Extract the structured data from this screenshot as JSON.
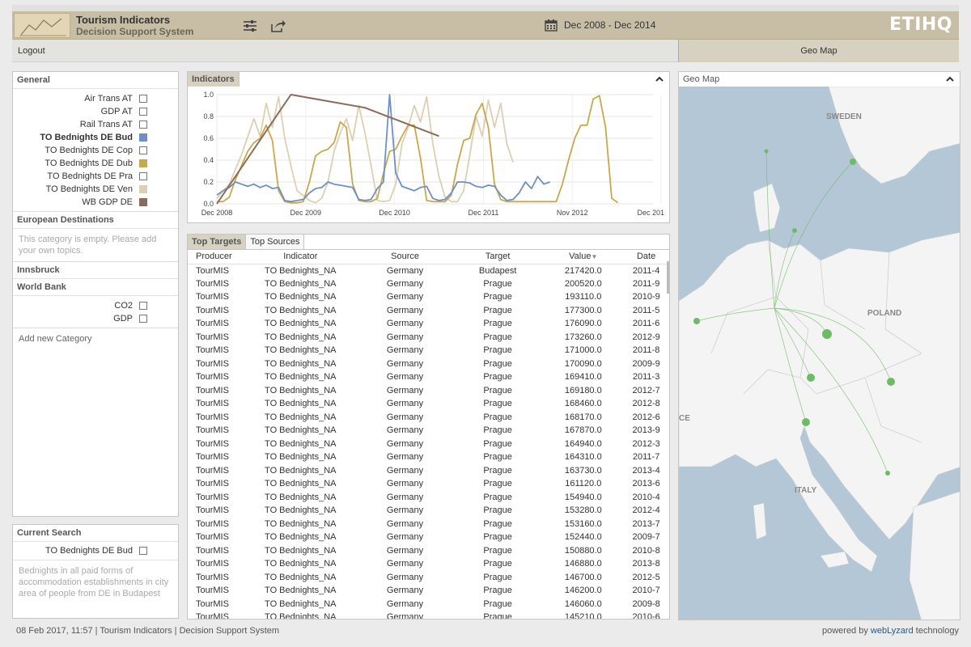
{
  "header": {
    "title": "Tourism Indicators",
    "subtitle": "Decision Support System",
    "date_range": "Dec 2008 - Dec 2014",
    "brand": "ETIHQ"
  },
  "menubar": {
    "logout": "Logout",
    "geo_tab": "Geo Map"
  },
  "sidebar": {
    "general_title": "General",
    "general_items": [
      {
        "label": "Air Trans AT",
        "color": ""
      },
      {
        "label": "GDP AT",
        "color": ""
      },
      {
        "label": "Rail Trans AT",
        "color": ""
      },
      {
        "label": "TO Bednights DE Bud",
        "color": "#6f8fc7"
      },
      {
        "label": "TO Bednights DE Cop",
        "color": ""
      },
      {
        "label": "TO Bednights DE Dub",
        "color": "#c9a84b"
      },
      {
        "label": "TO Bednights DE Pra",
        "color": ""
      },
      {
        "label": "TO Bednights DE Ven",
        "color": "#ddd0b2"
      },
      {
        "label": "WB GDP DE",
        "color": "#8b6b59"
      }
    ],
    "european_title": "European Destinations",
    "european_empty": "This category is empty. Please add your own topics.",
    "innsbruck_title": "Innsbruck",
    "worldbank_title": "World Bank",
    "worldbank_items": [
      "CO2",
      "GDP"
    ],
    "add_category": "Add new Category",
    "current_search_title": "Current Search",
    "current_search_item": "TO Bednights DE Bud",
    "current_search_desc": "Bednights in all paid forms of accommodation establishments in city area of people from DE in Budapest"
  },
  "indicators": {
    "tab": "Indicators"
  },
  "chart_data": {
    "type": "line",
    "x_tick_labels": [
      "Dec 2008",
      "Dec 2009",
      "Dec 2010",
      "Dec 2011",
      "Nov 2012",
      "Dec 201"
    ],
    "y_tick_labels": [
      "0.0",
      "0.2",
      "0.4",
      "0.6",
      "0.8",
      "1.0"
    ],
    "ylim": [
      0,
      1
    ],
    "x_range_months": [
      0,
      72
    ],
    "series": [
      {
        "name": "TO Bednights DE Ven",
        "color": "#ddd0b2",
        "values": [
          [
            0,
            0.05
          ],
          [
            2,
            0.18
          ],
          [
            4,
            0.45
          ],
          [
            6,
            0.78
          ],
          [
            7,
            0.62
          ],
          [
            8,
            0.92
          ],
          [
            9,
            0.7
          ],
          [
            10,
            0.98
          ],
          [
            11,
            0.6
          ],
          [
            12,
            0.35
          ],
          [
            13,
            0.12
          ],
          [
            15,
            0.03
          ],
          [
            16,
            0.01
          ],
          [
            17,
            0.05
          ],
          [
            18,
            0.2
          ],
          [
            19,
            0.48
          ],
          [
            20,
            0.65
          ],
          [
            21,
            0.78
          ],
          [
            22,
            0.58
          ],
          [
            23,
            0.9
          ],
          [
            24,
            0.65
          ],
          [
            25,
            0.35
          ],
          [
            26,
            0.03
          ],
          [
            27,
            0.02
          ],
          [
            28,
            0.03
          ],
          [
            29,
            0.18
          ],
          [
            30,
            0.55
          ],
          [
            31,
            0.7
          ],
          [
            32,
            0.9
          ],
          [
            33,
            0.75
          ],
          [
            34,
            0.98
          ],
          [
            35,
            0.55
          ],
          [
            36,
            0.25
          ],
          [
            37,
            0.06
          ],
          [
            38,
            0.02
          ],
          [
            39,
            0.02
          ],
          [
            40,
            0.12
          ],
          [
            41,
            0.45
          ],
          [
            42,
            0.8
          ],
          [
            43,
            0.62
          ],
          [
            44,
            0.95
          ],
          [
            45,
            0.7
          ],
          [
            46,
            0.92
          ],
          [
            47,
            0.55
          ],
          [
            48,
            0.38
          ]
        ]
      },
      {
        "name": "TO Bednights DE Dub",
        "color": "#c9a84b",
        "values": [
          [
            0,
            0.02
          ],
          [
            1,
            0.02
          ],
          [
            2,
            0.06
          ],
          [
            3,
            0.22
          ],
          [
            4,
            0.35
          ],
          [
            5,
            0.48
          ],
          [
            6,
            0.56
          ],
          [
            7,
            0.6
          ],
          [
            8,
            0.72
          ],
          [
            9,
            0.58
          ],
          [
            10,
            0.12
          ],
          [
            11,
            0.02
          ],
          [
            12,
            0.01
          ],
          [
            13,
            0.01
          ],
          [
            14,
            0.02
          ],
          [
            15,
            0.2
          ],
          [
            16,
            0.44
          ],
          [
            17,
            0.48
          ],
          [
            18,
            0.5
          ],
          [
            19,
            0.56
          ],
          [
            20,
            0.75
          ],
          [
            21,
            0.7
          ],
          [
            22,
            0.18
          ],
          [
            23,
            0.03
          ],
          [
            24,
            0.02
          ],
          [
            25,
            0.02
          ],
          [
            26,
            0.05
          ],
          [
            27,
            0.28
          ],
          [
            28,
            0.48
          ],
          [
            29,
            0.5
          ],
          [
            30,
            0.62
          ],
          [
            31,
            0.72
          ],
          [
            32,
            0.72
          ],
          [
            33,
            0.42
          ],
          [
            34,
            0.03
          ],
          [
            35,
            0.02
          ],
          [
            36,
            0.02
          ],
          [
            37,
            0.02
          ],
          [
            38,
            0.08
          ],
          [
            39,
            0.36
          ],
          [
            40,
            0.58
          ],
          [
            41,
            0.6
          ],
          [
            42,
            0.82
          ],
          [
            43,
            0.92
          ],
          [
            44,
            0.7
          ],
          [
            45,
            0.18
          ],
          [
            46,
            0.04
          ],
          [
            47,
            0.02
          ],
          [
            48,
            0.02
          ],
          [
            54,
            0.02
          ],
          [
            55,
            0.02
          ],
          [
            56,
            0.18
          ],
          [
            57,
            0.4
          ],
          [
            58,
            0.6
          ],
          [
            59,
            0.72
          ],
          [
            60,
            0.72
          ],
          [
            61,
            0.96
          ],
          [
            62,
            0.99
          ],
          [
            63,
            0.7
          ],
          [
            64,
            0.05
          ],
          [
            65,
            0.01
          ]
        ]
      },
      {
        "name": "TO Bednights DE Bud",
        "color": "#6f8fc7",
        "values": [
          [
            0,
            0.08
          ],
          [
            1,
            0.12
          ],
          [
            2,
            0.15
          ],
          [
            3,
            0.2
          ],
          [
            4,
            0.18
          ],
          [
            5,
            0.16
          ],
          [
            6,
            0.18
          ],
          [
            7,
            0.15
          ],
          [
            8,
            0.17
          ],
          [
            9,
            0.14
          ],
          [
            10,
            0.15
          ],
          [
            11,
            0.03
          ],
          [
            12,
            0.02
          ],
          [
            13,
            0.03
          ],
          [
            14,
            0.04
          ],
          [
            15,
            0.1
          ],
          [
            16,
            0.14
          ],
          [
            17,
            0.15
          ],
          [
            18,
            0.2
          ],
          [
            19,
            0.18
          ],
          [
            20,
            0.17
          ],
          [
            21,
            0.16
          ],
          [
            22,
            0.15
          ],
          [
            23,
            0.04
          ],
          [
            24,
            0.03
          ],
          [
            25,
            0.04
          ],
          [
            26,
            0.14
          ],
          [
            27,
            0.2
          ],
          [
            28,
            1.0
          ],
          [
            29,
            0.28
          ],
          [
            30,
            0.16
          ],
          [
            31,
            0.14
          ],
          [
            32,
            0.12
          ],
          [
            33,
            0.15
          ],
          [
            34,
            0.16
          ],
          [
            35,
            0.05
          ],
          [
            36,
            0.03
          ],
          [
            37,
            0.04
          ],
          [
            38,
            0.1
          ],
          [
            39,
            0.2
          ],
          [
            40,
            0.2
          ],
          [
            41,
            0.19
          ],
          [
            42,
            0.16
          ],
          [
            43,
            0.15
          ],
          [
            44,
            0.17
          ],
          [
            45,
            0.16
          ],
          [
            46,
            0.08
          ],
          [
            47,
            0.03
          ],
          [
            48,
            0.04
          ],
          [
            49,
            0.1
          ],
          [
            50,
            0.2
          ],
          [
            51,
            0.14
          ],
          [
            52,
            0.25
          ],
          [
            53,
            0.18
          ],
          [
            54,
            0.2
          ]
        ]
      },
      {
        "name": "WB GDP DE",
        "color": "#8b6b59",
        "values": [
          [
            0,
            0.0
          ],
          [
            12,
            1.0
          ],
          [
            24,
            0.88
          ],
          [
            36,
            0.62
          ]
        ]
      }
    ]
  },
  "targets": {
    "tabs": [
      "Top Targets",
      "Top Sources"
    ],
    "columns": [
      "Producer",
      "Indicator",
      "Source",
      "Target",
      "Value",
      "Date"
    ],
    "rows": [
      [
        "TourMIS",
        "TO Bednights_NA",
        "Germany",
        "Budapest",
        "217420.0",
        "2011-4"
      ],
      [
        "TourMIS",
        "TO Bednights_NA",
        "Germany",
        "Prague",
        "200520.0",
        "2011-9"
      ],
      [
        "TourMIS",
        "TO Bednights_NA",
        "Germany",
        "Prague",
        "193110.0",
        "2010-9"
      ],
      [
        "TourMIS",
        "TO Bednights_NA",
        "Germany",
        "Prague",
        "177300.0",
        "2011-5"
      ],
      [
        "TourMIS",
        "TO Bednights_NA",
        "Germany",
        "Prague",
        "176090.0",
        "2011-6"
      ],
      [
        "TourMIS",
        "TO Bednights_NA",
        "Germany",
        "Prague",
        "173260.0",
        "2012-9"
      ],
      [
        "TourMIS",
        "TO Bednights_NA",
        "Germany",
        "Prague",
        "171000.0",
        "2011-8"
      ],
      [
        "TourMIS",
        "TO Bednights_NA",
        "Germany",
        "Prague",
        "170090.0",
        "2009-9"
      ],
      [
        "TourMIS",
        "TO Bednights_NA",
        "Germany",
        "Prague",
        "169410.0",
        "2011-3"
      ],
      [
        "TourMIS",
        "TO Bednights_NA",
        "Germany",
        "Prague",
        "169180.0",
        "2012-7"
      ],
      [
        "TourMIS",
        "TO Bednights_NA",
        "Germany",
        "Prague",
        "168460.0",
        "2012-8"
      ],
      [
        "TourMIS",
        "TO Bednights_NA",
        "Germany",
        "Prague",
        "168170.0",
        "2012-6"
      ],
      [
        "TourMIS",
        "TO Bednights_NA",
        "Germany",
        "Prague",
        "167870.0",
        "2013-9"
      ],
      [
        "TourMIS",
        "TO Bednights_NA",
        "Germany",
        "Prague",
        "164940.0",
        "2012-3"
      ],
      [
        "TourMIS",
        "TO Bednights_NA",
        "Germany",
        "Prague",
        "164310.0",
        "2011-7"
      ],
      [
        "TourMIS",
        "TO Bednights_NA",
        "Germany",
        "Prague",
        "163730.0",
        "2013-4"
      ],
      [
        "TourMIS",
        "TO Bednights_NA",
        "Germany",
        "Prague",
        "161120.0",
        "2013-6"
      ],
      [
        "TourMIS",
        "TO Bednights_NA",
        "Germany",
        "Prague",
        "154940.0",
        "2010-4"
      ],
      [
        "TourMIS",
        "TO Bednights_NA",
        "Germany",
        "Prague",
        "153280.0",
        "2012-4"
      ],
      [
        "TourMIS",
        "TO Bednights_NA",
        "Germany",
        "Prague",
        "153160.0",
        "2013-7"
      ],
      [
        "TourMIS",
        "TO Bednights_NA",
        "Germany",
        "Prague",
        "152440.0",
        "2009-7"
      ],
      [
        "TourMIS",
        "TO Bednights_NA",
        "Germany",
        "Prague",
        "150880.0",
        "2010-8"
      ],
      [
        "TourMIS",
        "TO Bednights_NA",
        "Germany",
        "Prague",
        "146880.0",
        "2013-8"
      ],
      [
        "TourMIS",
        "TO Bednights_NA",
        "Germany",
        "Prague",
        "146700.0",
        "2012-5"
      ],
      [
        "TourMIS",
        "TO Bednights_NA",
        "Germany",
        "Prague",
        "146200.0",
        "2010-7"
      ],
      [
        "TourMIS",
        "TO Bednights_NA",
        "Germany",
        "Prague",
        "146060.0",
        "2009-8"
      ],
      [
        "TourMIS",
        "TO Bednights_NA",
        "Germany",
        "Prague",
        "145210.0",
        "2010-6"
      ]
    ]
  },
  "geomap": {
    "tab": "Geo Map",
    "labels": [
      "SWEDEN",
      "POLAND",
      "ITALY",
      "CE"
    ],
    "water_color": "#b3c7d7",
    "land_color": "#f4f4f4",
    "marker_color": "#6dbb62"
  },
  "footer": {
    "left": "08 Feb 2017, 11:57 | Tourism Indicators | Decision Support System",
    "powered": "powered by",
    "brand": "webLyzard",
    "tech": "technology"
  }
}
